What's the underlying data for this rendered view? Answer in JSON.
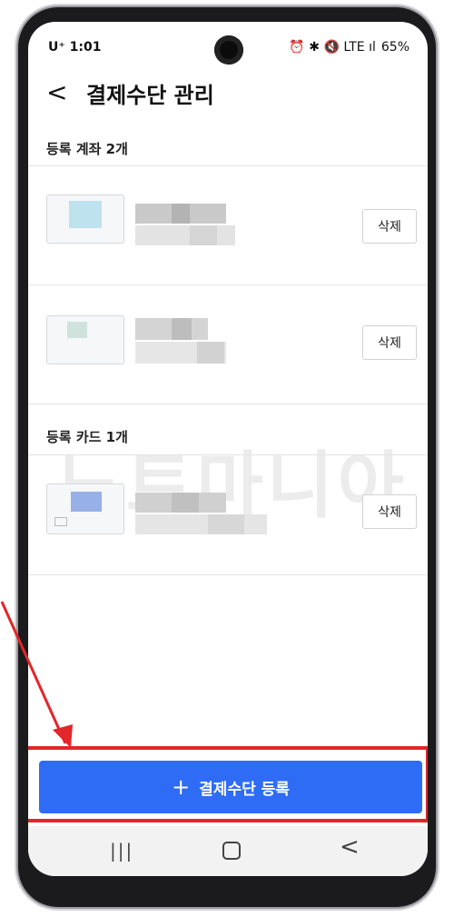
{
  "status": {
    "carrier": "U⁺ 1:01",
    "icons": "⏰ ✱ 🔇 LTE ıl",
    "battery": "65%"
  },
  "header": {
    "title": "결제수단 관리"
  },
  "sections": {
    "accounts_title": "등록 계좌 2개",
    "cards_title": "등록 카드 1개"
  },
  "items": [
    {
      "type": "account",
      "delete_label": "삭제",
      "accent": "#bfe2ef"
    },
    {
      "type": "account",
      "delete_label": "삭제",
      "accent": "#cfe3dc"
    },
    {
      "type": "card",
      "delete_label": "삭제",
      "accent": "#97b0e8"
    }
  ],
  "watermark": "노트마니아",
  "cta": {
    "label": "결제수단 등록"
  },
  "colors": {
    "cta_bg": "#2e6cf6",
    "highlight": "#e32629"
  }
}
